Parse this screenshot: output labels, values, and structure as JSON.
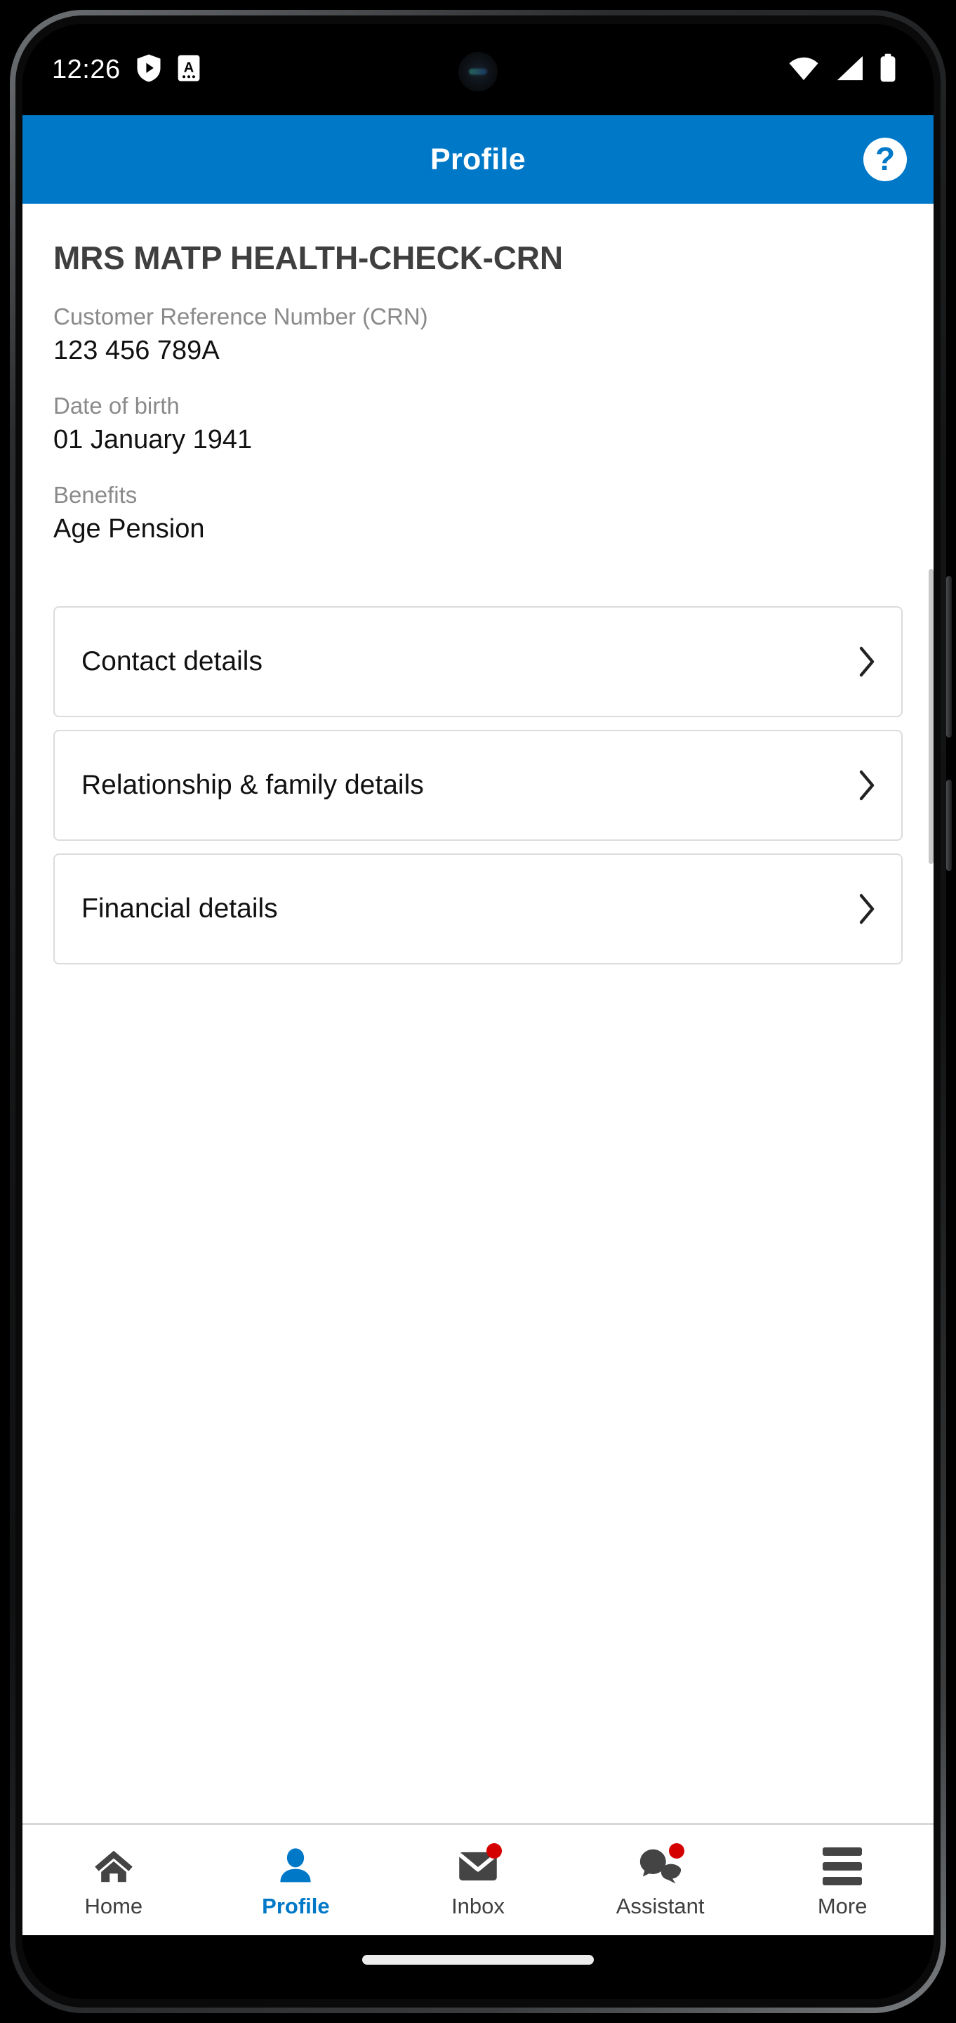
{
  "colors": {
    "brand_blue": "#0078c8",
    "badge_red": "#d40000",
    "name_gray": "#3f3f3f",
    "label_gray": "#8a8a8a",
    "card_border": "#dcdcdc"
  },
  "status_bar": {
    "time": "12:26",
    "icons": [
      "play-protect-shield-icon",
      "notification-letter-a-icon"
    ],
    "right_icons": [
      "wifi-icon",
      "cellular-signal-icon",
      "battery-icon"
    ]
  },
  "app_bar": {
    "title": "Profile",
    "help_label": "?"
  },
  "profile": {
    "name": "MRS MATP HEALTH-CHECK-CRN",
    "fields": [
      {
        "label": "Customer Reference Number (CRN)",
        "value": "123 456 789A"
      },
      {
        "label": "Date of birth",
        "value": "01 January 1941"
      },
      {
        "label": "Benefits",
        "value": "Age Pension"
      }
    ]
  },
  "cards": [
    {
      "label": "Contact details"
    },
    {
      "label": "Relationship & family details"
    },
    {
      "label": "Financial details"
    }
  ],
  "bottom_nav": [
    {
      "label": "Home",
      "icon": "home-icon",
      "active": false,
      "badge": false
    },
    {
      "label": "Profile",
      "icon": "person-icon",
      "active": true,
      "badge": false
    },
    {
      "label": "Inbox",
      "icon": "envelope-icon",
      "active": false,
      "badge": true
    },
    {
      "label": "Assistant",
      "icon": "chat-bubbles-icon",
      "active": false,
      "badge": true
    },
    {
      "label": "More",
      "icon": "hamburger-icon",
      "active": false,
      "badge": false
    }
  ]
}
